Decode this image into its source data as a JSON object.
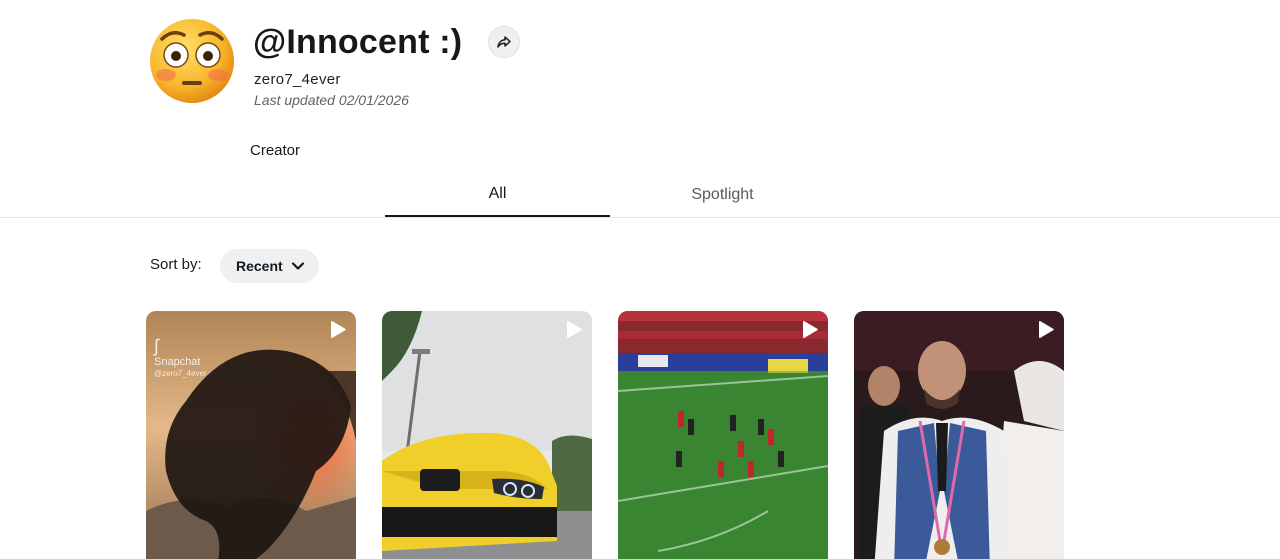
{
  "profile": {
    "title": "@Innocent :)",
    "username": "zero7_4ever",
    "last_updated": "Last updated 02/01/2026",
    "role": "Creator",
    "avatar_icon": "flushed-face-emoji",
    "share_icon": "share-arrow-icon"
  },
  "tabs": [
    {
      "label": "All",
      "active": true
    },
    {
      "label": "Spotlight",
      "active": false
    }
  ],
  "sort": {
    "label": "Sort by:",
    "selected": "Recent",
    "icon": "chevron-down-icon"
  },
  "tiles": [
    {
      "subject": "silhouette-animal-sunset",
      "watermark_brand": "Snapchat",
      "watermark_user": "@zero7_4ever",
      "icon": "play-icon"
    },
    {
      "subject": "yellow-bmw-car",
      "icon": "play-icon"
    },
    {
      "subject": "football-match-stadium",
      "icon": "play-icon"
    },
    {
      "subject": "man-in-vest-at-event",
      "icon": "play-icon"
    }
  ]
}
